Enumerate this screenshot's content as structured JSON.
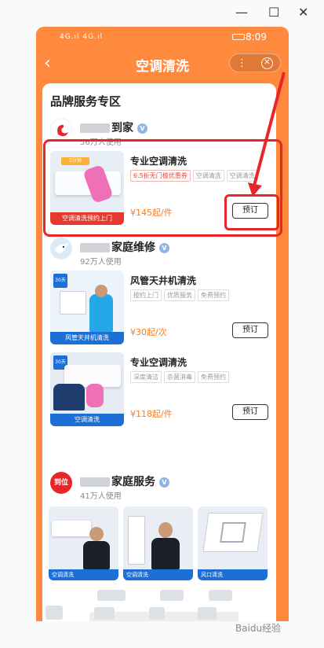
{
  "nav": {
    "title": "空调清洗",
    "back_icon": "chevron-left-icon",
    "more_icon": "more-dots-icon",
    "close_icon": "close-circle-icon"
  },
  "status_bar": {
    "signal": "4G.ıl 4G.ıl",
    "time": "8:09"
  },
  "section": {
    "title": "品牌服务专区"
  },
  "brands": [
    {
      "name": "到家",
      "usage": "56万人使用",
      "badge": "V"
    },
    {
      "name": "家庭维修",
      "usage": "92万人使用",
      "badge": "V"
    },
    {
      "name": "家庭服务",
      "usage": "41万人使用",
      "badge": "V",
      "logo_text": "到位"
    }
  ],
  "services": [
    {
      "name": "专业空调清洗",
      "tags": [
        "6.5折无门槛优惠券",
        "空调清洗",
        "空调清洗"
      ],
      "price": "¥145起/件",
      "order": "预订",
      "thumb_banner": "空调清洗预约上门",
      "thumb_badge": "5分钟"
    },
    {
      "name": "风管天井机清洗",
      "tags": [
        "按约上门",
        "优质服务",
        "免费预约"
      ],
      "price": "¥30起/次",
      "order": "预订",
      "thumb_banner": "风管天井机清洗",
      "thumb_badge": "30天"
    },
    {
      "name": "专业空调清洗",
      "tags": [
        "深度清洁",
        "杀菌消毒",
        "免费预约"
      ],
      "price": "¥118起/件",
      "order": "预订",
      "thumb_banner": "空调清洗",
      "thumb_badge": "30天"
    }
  ],
  "gallery": [
    {
      "label": "空调清洗"
    },
    {
      "label": "空调清洗"
    },
    {
      "label": "风口清洗"
    }
  ],
  "colors": {
    "accent": "#ff8a3d",
    "price": "#ff7a1a",
    "highlight": "#e8262a"
  },
  "watermark": "Baidu经验"
}
